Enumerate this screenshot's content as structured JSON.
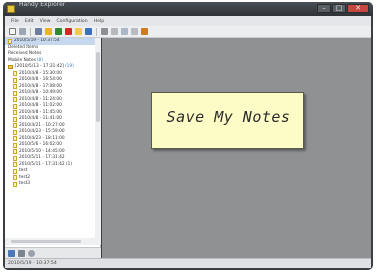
{
  "window": {
    "title": "Handy Explorer",
    "controls": [
      "–",
      "□",
      "✕"
    ]
  },
  "menu": [
    "File",
    "Edit",
    "View",
    "Configuration",
    "Help"
  ],
  "toolbar": {
    "icons": [
      "new-note-icon",
      "edit-icon",
      "back-icon",
      "star-icon",
      "leaf-icon",
      "delete-icon",
      "folder-icon",
      "image-icon",
      "grid-icon",
      "list-icon",
      "check-icon",
      "undo-icon",
      "pin-icon"
    ],
    "colors": {
      "red": "#d02a22",
      "green": "#2f8a2f",
      "yellow": "#e5b81f",
      "blue": "#3a6fc3",
      "gray": "#8c8f93"
    }
  },
  "sidebar": {
    "items": [
      {
        "label": "2010/5/19 - 10:37:54",
        "level": 0,
        "icon": "note",
        "selected": true
      },
      {
        "label": "Deleted Items",
        "level": 0,
        "icon": "none"
      },
      {
        "label": "Received Notes",
        "level": 0,
        "icon": "none"
      },
      {
        "label": "Mobile Notes",
        "badge": "(8)",
        "level": 0,
        "icon": "none"
      },
      {
        "label": "[2010/5/13 - 17:31:42]",
        "badge": "(19)",
        "level": 0,
        "icon": "folder"
      },
      {
        "label": "2010/4/8 - 15:30:00",
        "level": 1,
        "icon": "note"
      },
      {
        "label": "2010/4/8 - 16:54:00",
        "level": 1,
        "icon": "note"
      },
      {
        "label": "2010/4/8 - 17:08:00",
        "level": 1,
        "icon": "note"
      },
      {
        "label": "2010/4/8 - 10:49:00",
        "level": 1,
        "icon": "note"
      },
      {
        "label": "2010/4/8 - 11:24:00",
        "level": 1,
        "icon": "note"
      },
      {
        "label": "2010/4/8 - 11:02:00",
        "level": 1,
        "icon": "note"
      },
      {
        "label": "2010/4/8 - 11:45:00",
        "level": 1,
        "icon": "note"
      },
      {
        "label": "2010/4/8 - 11:41:00",
        "level": 1,
        "icon": "note"
      },
      {
        "label": "2010/4/21 - 10:27:00",
        "level": 1,
        "icon": "note"
      },
      {
        "label": "2010/4/23 - 15:59:00",
        "level": 1,
        "icon": "note"
      },
      {
        "label": "2010/4/23 - 18:11:00",
        "level": 1,
        "icon": "note"
      },
      {
        "label": "2010/5/6 - 16:02:00",
        "level": 1,
        "icon": "note"
      },
      {
        "label": "2010/5/10 - 14:45:00",
        "level": 1,
        "icon": "note"
      },
      {
        "label": "2010/5/11 - 17:31:42",
        "level": 1,
        "icon": "note"
      },
      {
        "label": "2010/5/11 - 17:31:42 (1)",
        "level": 1,
        "icon": "note"
      },
      {
        "label": "test",
        "level": 1,
        "icon": "note"
      },
      {
        "label": "test2",
        "level": 1,
        "icon": "note"
      },
      {
        "label": "test3",
        "level": 1,
        "icon": "note"
      }
    ]
  },
  "note": {
    "text": "Save My Notes"
  },
  "status": {
    "text": "2010/5/19 - 10:37:54"
  }
}
